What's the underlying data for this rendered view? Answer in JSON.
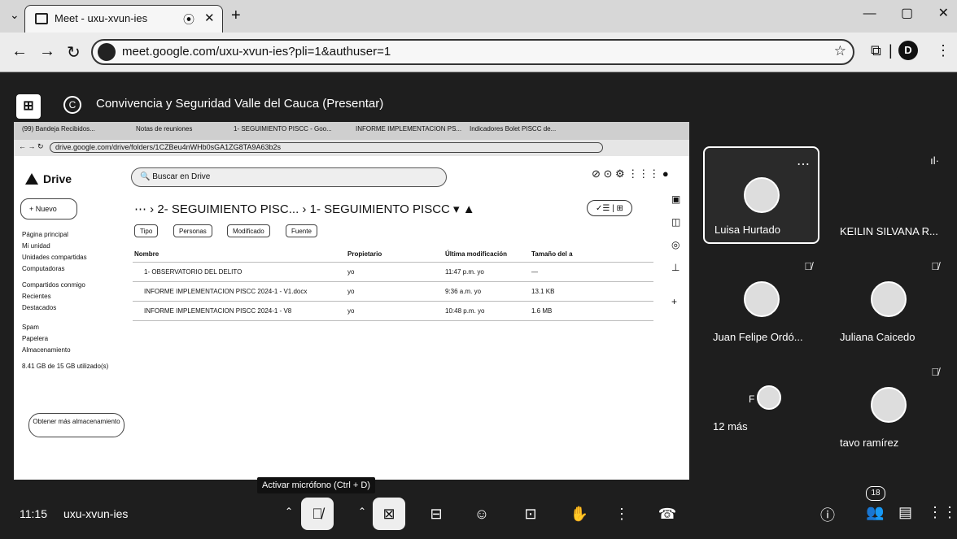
{
  "browser": {
    "tab_title": "Meet - uxu-xvun-ies",
    "tab_record_icon": "record-icon",
    "url": "meet.google.com/uxu-xvun-ies?pli=1&authuser=1",
    "profile_initial": "D"
  },
  "meet": {
    "presentation_title": "Convivencia y Seguridad Valle del Cauca (Presentar)",
    "presenter_initial": "C",
    "meeting_code": "uxu-xvun-ies",
    "time": "11:15",
    "tooltip": "Activar micrófono (Ctrl + D)",
    "people_count": "18",
    "participants": [
      {
        "name": "Luisa Hurtado",
        "muted": false,
        "active": true
      },
      {
        "name": "KEILIN SILVANA R...",
        "muted": false,
        "active": false
      },
      {
        "name": "Juan Felipe Ordó...",
        "muted": true,
        "active": false
      },
      {
        "name": "Juliana Caicedo",
        "muted": true,
        "active": false
      },
      {
        "name": "12 más",
        "muted": false,
        "active": false
      },
      {
        "name": "tavo ramírez",
        "muted": true,
        "active": false
      }
    ],
    "others_initial": "F"
  },
  "shared": {
    "tabs": [
      "(99) Bandeja Recibidos...",
      "Notas de reuniones",
      "1- SEGUIMIENTO PISCC - Goo...",
      "INFORME IMPLEMENTACION PS...",
      "Indicadores Bolet PISCC de..."
    ],
    "url": "drive.google.com/drive/folders/1CZBeu4nWHb0sGA1ZG8TA9A63b2s",
    "drive_label": "Drive",
    "search_placeholder": "Buscar en Drive",
    "new_label": "Nuevo",
    "sidebar": [
      "Página principal",
      "Mi unidad",
      "Unidades compartidas",
      "Computadoras",
      "Compartidos conmigo",
      "Recientes",
      "Destacados",
      "Spam",
      "Papelera",
      "Almacenamiento"
    ],
    "storage_text": "8.41 GB de 15 GB utilizado(s)",
    "storage_button": "Obtener más almacenamiento",
    "breadcrumb_parent": "2- SEGUIMIENTO PISC...",
    "breadcrumb_current": "1- SEGUIMIENTO PISCC",
    "filters": [
      "Tipo",
      "Personas",
      "Modificado",
      "Fuente"
    ],
    "columns": [
      "Nombre",
      "Propietario",
      "Última modificación",
      "Tamaño del a"
    ],
    "rows": [
      {
        "name": "1- OBSERVATORIO DEL DELITO",
        "owner": "yo",
        "modified": "11:47 p.m. yo",
        "size": "—"
      },
      {
        "name": "INFORME IMPLEMENTACION PISCC 2024-1 - V1.docx",
        "owner": "yo",
        "modified": "9:36 a.m. yo",
        "size": "13.1 KB"
      },
      {
        "name": "INFORME IMPLEMENTACION PISCC 2024-1 - V8",
        "owner": "yo",
        "modified": "10:48 p.m. yo",
        "size": "1.6 MB"
      }
    ]
  }
}
